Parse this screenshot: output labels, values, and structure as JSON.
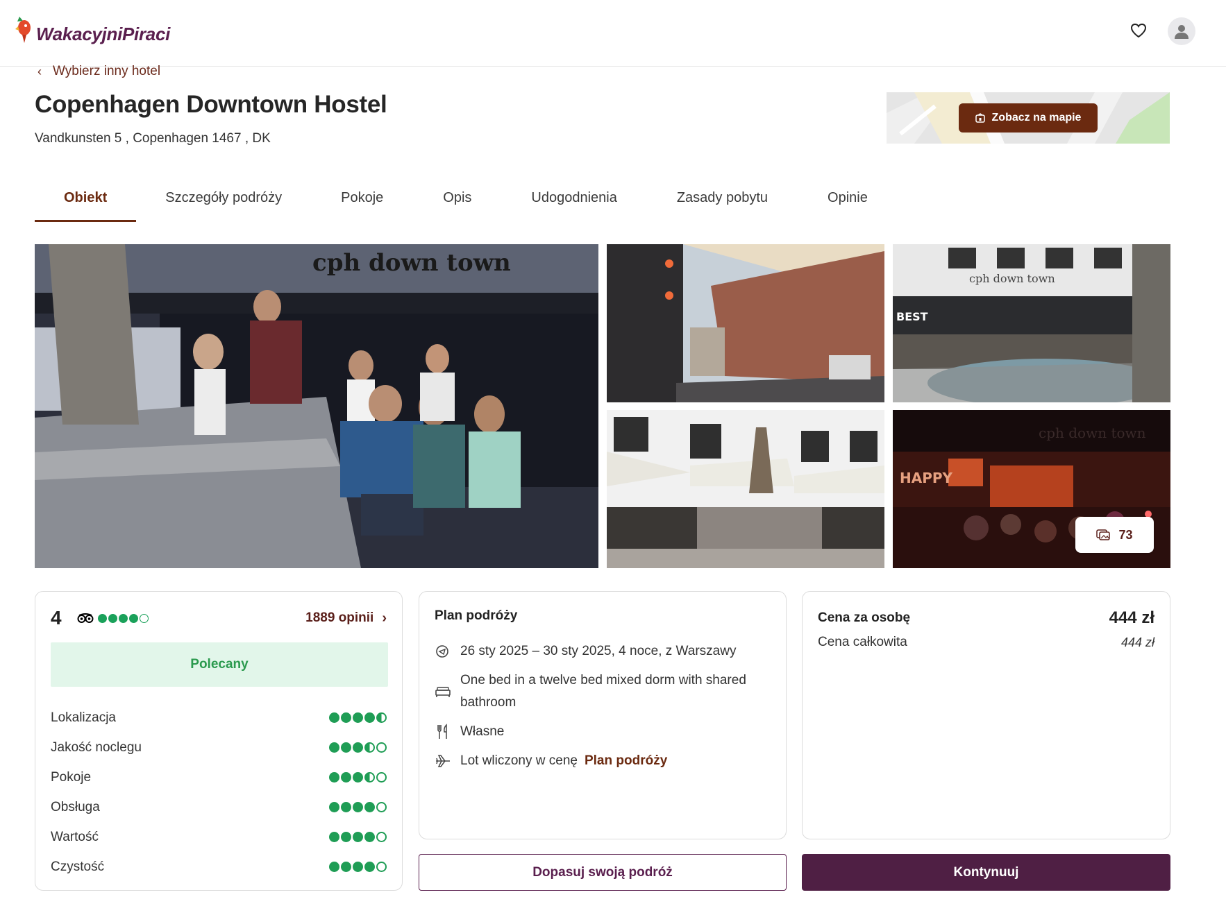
{
  "header": {
    "logo_text": "WakacyjniPiraci",
    "brand_color": "#5a1f4e",
    "accent_color": "#6b2a10",
    "favorites_icon": "heart-icon",
    "account_icon": "user-icon"
  },
  "back_link": {
    "label": "Wybierz inny hotel"
  },
  "hotel": {
    "name": "Copenhagen Downtown Hostel",
    "address": "Vandkunsten 5 , Copenhagen 1467 , DK"
  },
  "map": {
    "button_label": "Zobacz na mapie"
  },
  "tabs": [
    {
      "label": "Obiekt",
      "active": true
    },
    {
      "label": "Szczegóły podróży",
      "active": false
    },
    {
      "label": "Pokoje",
      "active": false
    },
    {
      "label": "Opis",
      "active": false
    },
    {
      "label": "Udogodnienia",
      "active": false
    },
    {
      "label": "Zasady pobytu",
      "active": false
    },
    {
      "label": "Opinie",
      "active": false
    }
  ],
  "gallery": {
    "photo_count": "73"
  },
  "rating": {
    "score": "4",
    "score_bubbles": 4,
    "reviews_label": "1889 opinii",
    "recommended_label": "Polecany",
    "categories": [
      {
        "label": "Lokalizacja",
        "value": 4.5
      },
      {
        "label": "Jakość noclegu",
        "value": 3.5
      },
      {
        "label": "Pokoje",
        "value": 3.5
      },
      {
        "label": "Obsługa",
        "value": 4
      },
      {
        "label": "Wartość",
        "value": 4
      },
      {
        "label": "Czystość",
        "value": 4
      }
    ]
  },
  "plan": {
    "title": "Plan podróży",
    "dates": "26 sty 2025 – 30 sty 2025, 4 noce, z Warszawy",
    "room": "One bed in a twelve bed mixed dorm with shared bathroom",
    "board": "Własne",
    "flight_text": "Lot wliczony w cenę",
    "flight_link": "Plan podróży"
  },
  "price": {
    "per_person_label": "Cena za osobę",
    "per_person_value": "444 zł",
    "total_label": "Cena całkowita",
    "total_value": "444 zł"
  },
  "actions": {
    "customize_label": "Dopasuj swoją podróż",
    "continue_label": "Kontynuuj"
  }
}
